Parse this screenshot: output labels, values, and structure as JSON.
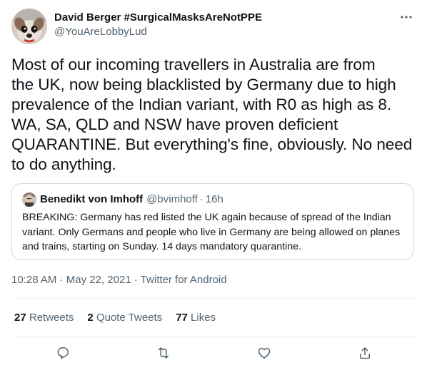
{
  "author": {
    "display_name": "David Berger #SurgicalMasksAreNotPPE",
    "handle": "@YouAreLobbyLud",
    "avatar_icon": "dog-avatar"
  },
  "tweet": {
    "text": "Most of our incoming travellers in Australia are from\nthe UK, now being blacklisted by Germany due to high\nprevalence of the Indian variant, with R0 as high as 8.\nWA, SA, QLD and NSW have proven deficient\nQUARANTINE. But everything's fine, obviously. No need\nto do anything."
  },
  "quoted": {
    "display_name": "Benedikt von Imhoff",
    "handle": "@bvimhoff",
    "separator": "·",
    "time": "16h",
    "text": "BREAKING: Germany has red listed the UK again because of spread of the Indian variant. Only Germans and people who live in Germany are being allowed on planes and trains, starting on Sunday. 14 days mandatory quarantine."
  },
  "meta": {
    "time": "10:28 AM",
    "sep1": " · ",
    "date": "May 22, 2021",
    "sep2": " · ",
    "source": "Twitter for Android"
  },
  "stats": {
    "retweets_count": "27",
    "retweets_label": "Retweets",
    "quotes_count": "2",
    "quotes_label": "Quote Tweets",
    "likes_count": "77",
    "likes_label": "Likes"
  },
  "colors": {
    "text": "#0f1419",
    "muted": "#536471",
    "border": "#cfd9de",
    "divider": "#eff3f4"
  },
  "icons": [
    "more-icon",
    "reply-icon",
    "retweet-icon",
    "like-icon",
    "share-icon"
  ]
}
